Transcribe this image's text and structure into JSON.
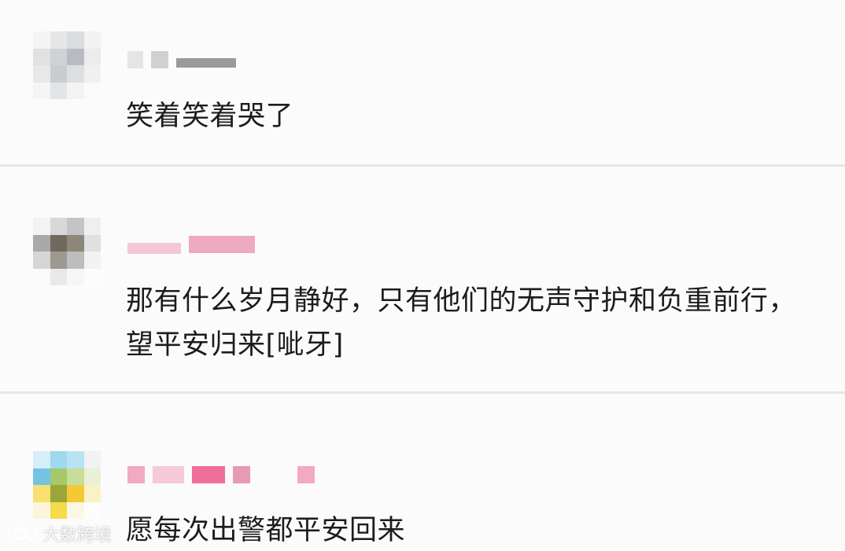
{
  "comments": [
    {
      "username": "",
      "text": "笑着笑着哭了",
      "avatar_colors": [
        "#f4f4f4",
        "#e6e6e6",
        "#d9dce0",
        "#f2f2f2",
        "#dfe1e3",
        "#cfd2d6",
        "#b8bcc2",
        "#ececec",
        "#e8e8e8",
        "#c9ccd1",
        "#dcdfe2",
        "#f0f0f0",
        "#f5f5f5",
        "#e2e4e6",
        "#f3f3f3",
        "#fafafa"
      ],
      "name_colors": [
        "#e5e5e5",
        "#d0d0d0",
        "#9a9a9a"
      ]
    },
    {
      "username": "",
      "text": "那有什么岁月静好，只有他们的无声守护和负重前行，望平安归来[呲牙]",
      "avatar_colors": [
        "#f3f3f3",
        "#d8d8d8",
        "#c4c4c4",
        "#efefef",
        "#a9a9a9",
        "#6f6a5c",
        "#8c8778",
        "#e0e0e0",
        "#d5d5d5",
        "#9c9a90",
        "#bdbdbd",
        "#f2f2f2",
        "#fafafa",
        "#e9e9e9",
        "#f6f6f6",
        "#fcfcfc"
      ],
      "name_colors": [
        "#f6c6d6",
        "#f0a9c2",
        "#e8789f"
      ]
    },
    {
      "username": "",
      "text": "愿每次出警都平安回来",
      "avatar_colors": [
        "#d6eef7",
        "#9ed9ee",
        "#b8e3f2",
        "#f2f2f2",
        "#74c3e2",
        "#a7c86a",
        "#c9dd9a",
        "#e8f1d6",
        "#f7e070",
        "#9aa63a",
        "#f3c934",
        "#f9f2c6",
        "#fbf6da",
        "#f4dc4a",
        "#fcf7e3",
        "#fdfdfd"
      ],
      "name_colors": [
        "#f2a9c3",
        "#f6c9d8",
        "#ee6f9c",
        "#e79ab5"
      ]
    }
  ],
  "watermark": {
    "text": "大数跨境",
    "icon": "brand-logo-icon"
  }
}
